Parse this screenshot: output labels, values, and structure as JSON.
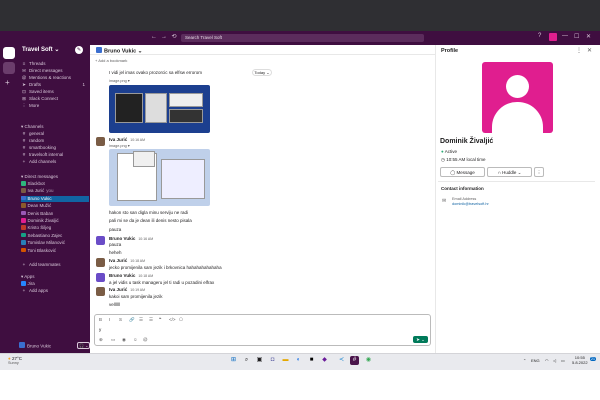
{
  "topbar": {
    "search": "Search Travel Soft",
    "nav": [
      "←",
      "→",
      "⟲"
    ]
  },
  "sidebar": {
    "workspace": "Travel Soft",
    "items": [
      {
        "icon": "≡",
        "label": "Threads"
      },
      {
        "icon": "✉",
        "label": "Direct messages"
      },
      {
        "icon": "@",
        "label": "Mentions & reactions"
      },
      {
        "icon": "➤",
        "label": "Drafts",
        "badge": "1"
      },
      {
        "icon": "⊡",
        "label": "Saved items"
      },
      {
        "icon": "⊞",
        "label": "Slack Connect"
      },
      {
        "icon": "⋮",
        "label": "More"
      }
    ],
    "channels_header": "Channels",
    "channels": [
      "general",
      "random",
      "smartbooking",
      "travelsoft internal"
    ],
    "add_channels": "Add channels",
    "dms_header": "Direct messages",
    "dms": [
      {
        "name": "Slackbot",
        "color": "#2eb67d"
      },
      {
        "name": "Iva Jurić",
        "suffix": "you",
        "color": "#7a5c45"
      },
      {
        "name": "Bruno Vukic",
        "color": "#3a6ecf",
        "selected": true
      },
      {
        "name": "Dean Mužić",
        "color": "#8b5a2b"
      },
      {
        "name": "Denis Baban",
        "color": "#9b59b6"
      },
      {
        "name": "Dominik Živaljić",
        "color": "#e01e8f"
      },
      {
        "name": "Kristo Šiljeg",
        "color": "#c0392b"
      },
      {
        "name": "Sebastiano Zajec",
        "color": "#16a085"
      },
      {
        "name": "Tomislav Milanović",
        "color": "#2980b9"
      },
      {
        "name": "Toni Blasković",
        "color": "#d35400"
      }
    ],
    "add_teammates": "Add teammates",
    "apps_header": "Apps",
    "apps": [
      "Jira"
    ],
    "add_apps": "Add apps",
    "user": "Bruno Vukic"
  },
  "channel": {
    "name": "Bruno Vukic",
    "bookmark": "+ Add a bookmark",
    "today": "Today ⌄"
  },
  "messages": [
    {
      "text": "I vidi jel imas ovako prozorcic sa elfsw errorom"
    },
    {
      "file": "image.png ▾"
    },
    {
      "author": "Iva Jurić",
      "time": "10:16 AM",
      "file": "image.png ▾"
    },
    {
      "text": "hakon sto san digla minu serviju ne radi"
    },
    {
      "text": "pali mi se da je dean ili denis nesto pisala"
    },
    {
      "text": "pauza"
    },
    {
      "author": "Bruno Vukic",
      "time": "10:16 AM",
      "lines": [
        "pauza",
        "heheh"
      ]
    },
    {
      "author": "Iva Jurić",
      "time": "10:18 AM",
      "lines": [
        "jecko promijenila sam jezik i brkovnica hahahahahahaha"
      ]
    },
    {
      "author": "Bruno Vukic",
      "time": "10:18 AM",
      "lines": [
        "a jel vidis u task manageru jel ti radi u pozadini elfrax"
      ]
    },
    {
      "author": "Iva Jurić",
      "time": "10:19 AM",
      "lines": [
        "kakoi sam promijenila jezik",
        "vellllll"
      ]
    }
  ],
  "composer": {
    "tools": [
      "B",
      "I",
      "S",
      "🔗",
      "☰",
      "☰",
      "❝",
      "</>",
      "⎔"
    ],
    "value": "y",
    "send": "➤ ⌄"
  },
  "profile": {
    "title": "Profile",
    "name": "Dominik Živaljić",
    "status": "Active",
    "local_time": "10:55 AM local time",
    "buttons": [
      "Message",
      "Huddle",
      "⋮"
    ],
    "contact_header": "Contact information",
    "email_label": "Email Address",
    "email": "dominik@travelsoft.hr",
    "accent": "#e01e8f"
  },
  "taskbar": {
    "temp": "27°C",
    "weather": "Sunny",
    "lang": "ENG",
    "time": "10:55",
    "date": "5.8.2022",
    "notif": "21"
  }
}
